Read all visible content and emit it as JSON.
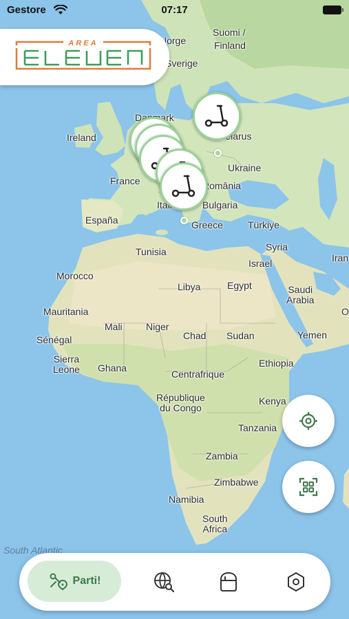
{
  "status_bar": {
    "carrier": "Gestore",
    "time": "07:17"
  },
  "brand": {
    "name": "AREA ELEVEN",
    "accent_color": "#e07a3c",
    "secondary_color": "#3e9b5b"
  },
  "map": {
    "ocean_label": "South Atlantic",
    "labels": {
      "suomi": "Suomi /",
      "finland": "Finland",
      "norge": "Norge",
      "sverige": "Sverige",
      "ireland": "Ireland",
      "danmark": "Danmark",
      "belarus": "Belarus",
      "ukraine": "Ukraine",
      "france": "France",
      "romania": "România",
      "bulgaria": "Bulgaria",
      "italia": "Italia",
      "espana": "España",
      "greece": "Greece",
      "turkiye": "Türkiye",
      "tunisia": "Tunisia",
      "syria": "Syria",
      "iran": "Iran",
      "israel": "Israel",
      "morocco": "Morocco",
      "libya": "Libya",
      "egypt": "Egypt",
      "saudi_arabia": "Saudi\nArabia",
      "mauritania": "Mauritania",
      "mali": "Mali",
      "niger": "Niger",
      "oman": "O",
      "senegal": "Sénégal",
      "chad": "Chad",
      "sudan": "Sudan",
      "yemen": "Yemen",
      "sierra_leone": "Sierra\nLeone",
      "ghana": "Ghana",
      "centrafrique": "Centrafrique",
      "ethiopia": "Ethiopia",
      "rdc": "République\ndu Congo",
      "kenya": "Kenya",
      "tanzania": "Tanzania",
      "zambia": "Zambia",
      "zimbabwe": "Zimbabwe",
      "namibia": "Namibia",
      "south_africa": "South\nAfrica"
    }
  },
  "markers": {
    "icon": "scooter-icon",
    "count_visible": 6,
    "color": "#9cd19a"
  },
  "fabs": {
    "locate_icon": "crosshair-icon",
    "scan_icon": "qr-scan-icon"
  },
  "bottom_nav": {
    "primary_label": "Parti!",
    "primary_icon": "route-icon",
    "items": [
      {
        "icon": "globe-search-icon"
      },
      {
        "icon": "bag-icon"
      },
      {
        "icon": "settings-hexagon-icon"
      }
    ],
    "accent": "#3c7a4a",
    "pill_bg": "#d7ecd7"
  }
}
